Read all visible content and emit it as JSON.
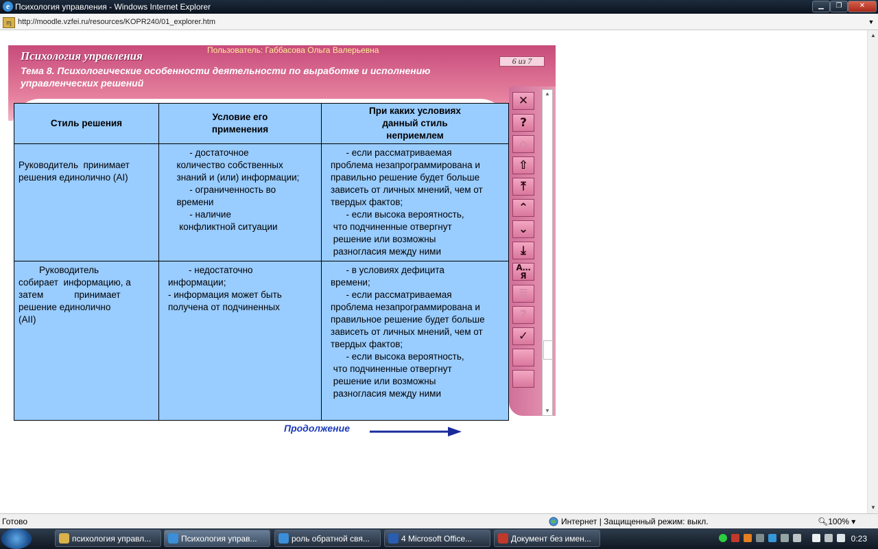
{
  "window": {
    "title": "Психология управления - Windows Internet Explorer",
    "minimize": "▁",
    "maximize": "❐",
    "close": "✕"
  },
  "address": {
    "url": "http://moodle.vzfei.ru/resources/KOPR240/01_explorer.htm",
    "icon": "page-icon",
    "dropdown": "▼"
  },
  "course": {
    "name": "Психология управления",
    "user": "Пользователь: Габбасова Ольга Валерьевна",
    "topic": "Тема 8.  Психологические особенности деятельности по выработке и исполнению управленческих решений",
    "page": "6 из 7"
  },
  "sidebar": {
    "buttons": [
      {
        "name": "close-icon",
        "glyph": "✕",
        "enabled": true
      },
      {
        "name": "help-icon",
        "glyph": "?",
        "enabled": true
      },
      {
        "name": "home-icon",
        "glyph": "⌂",
        "enabled": false
      },
      {
        "name": "arrow-up-bold-icon",
        "glyph": "⇧",
        "enabled": true
      },
      {
        "name": "arrow-top-icon",
        "glyph": "⤒",
        "enabled": true
      },
      {
        "name": "chevron-up-icon",
        "glyph": "⌃",
        "enabled": true
      },
      {
        "name": "chevron-down-icon",
        "glyph": "⌄",
        "enabled": true
      },
      {
        "name": "arrow-bottom-icon",
        "glyph": "⤓",
        "enabled": true
      },
      {
        "name": "glossary-icon",
        "glyph": "А…Я",
        "enabled": true
      },
      {
        "name": "document-icon",
        "glyph": "≣",
        "enabled": false
      },
      {
        "name": "quiz-icon",
        "glyph": "?",
        "enabled": false
      },
      {
        "name": "check-icon",
        "glyph": "✓",
        "enabled": true
      },
      {
        "name": "blank-button-1",
        "glyph": "",
        "enabled": false
      },
      {
        "name": "blank-button-2",
        "glyph": "",
        "enabled": false
      }
    ]
  },
  "table": {
    "headers": [
      "Стиль решения",
      "Условие его\nприменения",
      "При каких условиях\nданный стиль\nнеприемлем"
    ],
    "rows": [
      [
        "\nРуководитель  принимает\nрешения единолично (AI)",
        "       - достаточное\n  количество собственных\n  знаний и (или) информации;\n       - ограниченность во\n  времени\n       - наличие\n   конфликтной ситуации",
        "      - если рассматриваемая\nпроблема незапрограммирована и\nправильно решение будет больше\nзависеть от личных мнений, чем от\nтвердых фактов;\n      - если высока вероятность,\n что подчиненные отвергнут\n решение или возможны\n разногласия между ними"
      ],
      [
        "        Руководитель\nсобирает  информацию, а\nзатем            принимает\nрешение единолично\n(AII)",
        "        - недостаточно\nинформации;\n- информация может быть\nполучена от подчиненных",
        "      - в условиях дефицита\nвремени;\n      - если рассматриваемая\nпроблема незапрограммирована и\nправильное решение будет больше\nзависеть от личных мнений, чем от\nтвердых фактов;\n      - если высока вероятность,\n что подчиненные отвергнут\n решение или возможны\n разногласия между ними"
      ]
    ]
  },
  "continue_label": "Продолжение",
  "status": {
    "ready": "Готово",
    "zone": "Интернет | Защищенный режим: выкл.",
    "zoom": "100%"
  },
  "taskbar": {
    "items": [
      {
        "label": "психология управл...",
        "icon": "folder-icon",
        "color": "#d9b14a"
      },
      {
        "label": "Психология управ...",
        "icon": "ie-icon",
        "color": "#3a8fd8",
        "active": true
      },
      {
        "label": "роль обратной свя...",
        "icon": "ie-icon",
        "color": "#3a8fd8"
      },
      {
        "label": "4 Microsoft Office...",
        "icon": "word-icon",
        "color": "#2a5db0"
      },
      {
        "label": "Документ без имен...",
        "icon": "app-icon",
        "color": "#c0392b"
      }
    ],
    "clock": "0:23"
  }
}
